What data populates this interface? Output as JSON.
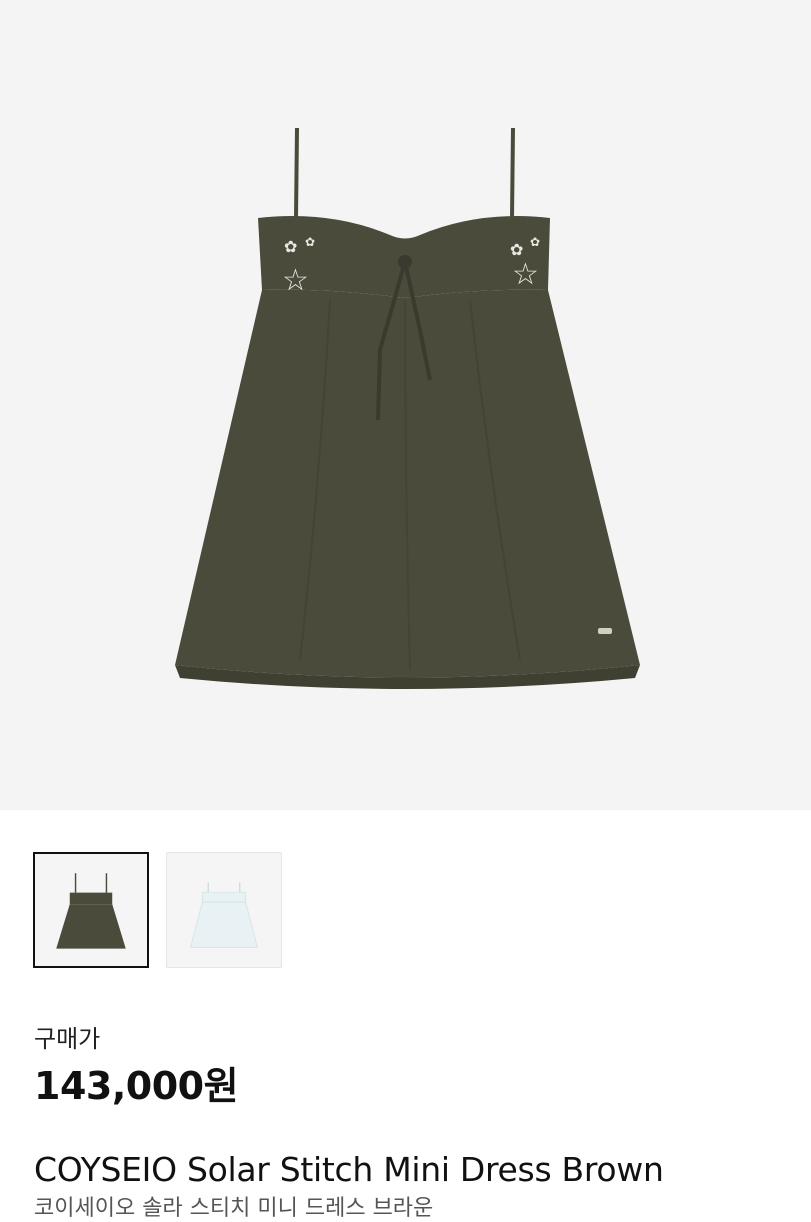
{
  "product": {
    "main_image_alt": "olive brown mini dress with star embroidery",
    "thumbnails": [
      {
        "label": "Brown",
        "color": "#4a4a3a",
        "selected": true
      },
      {
        "label": "White",
        "color": "#e8f2f4",
        "selected": false
      }
    ],
    "price_label": "구매가",
    "price": "143,000원",
    "title": "COYSEIO Solar Stitch Mini Dress Brown",
    "subtitle": "코이세이오 솔라 스티치 미니 드레스 브라운"
  },
  "colors": {
    "dress": "#4a4b3b",
    "background": "#f4f4f4"
  }
}
